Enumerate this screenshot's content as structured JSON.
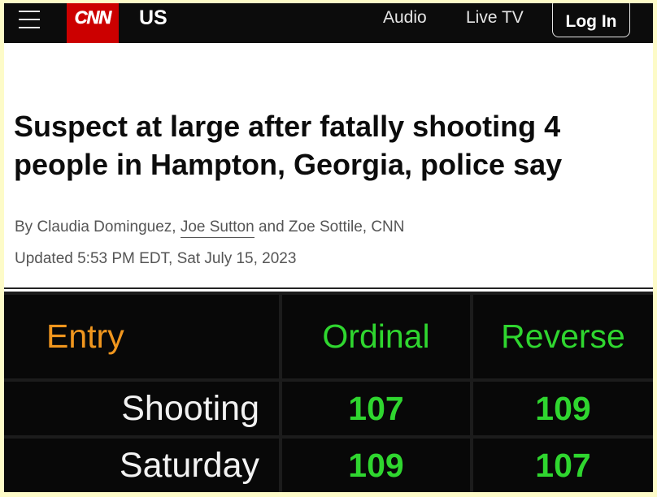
{
  "nav": {
    "logo": "CNN",
    "section": "US",
    "links": [
      "Audio",
      "Live TV"
    ],
    "login": "Log In"
  },
  "article": {
    "headline": "Suspect at large after fatally shooting 4 people in Hampton, Georgia, police say",
    "byline_prefix": "By Claudia Dominguez, ",
    "byline_link": "Joe Sutton",
    "byline_suffix": " and Zoe Sottile, CNN",
    "updated": "Updated 5:53 PM EDT, Sat July 15, 2023"
  },
  "cipher_table": {
    "headers": [
      "Entry",
      "Ordinal",
      "Reverse"
    ],
    "rows": [
      {
        "entry": "Shooting",
        "ordinal": "107",
        "reverse": "109"
      },
      {
        "entry": "Saturday",
        "ordinal": "109",
        "reverse": "107"
      }
    ]
  },
  "colors": {
    "brand_red": "#cc0000",
    "entry_header": "#f0961e",
    "value_green": "#2fd62f",
    "background": "#fdfbc8"
  },
  "icons": [
    "menu-icon"
  ]
}
